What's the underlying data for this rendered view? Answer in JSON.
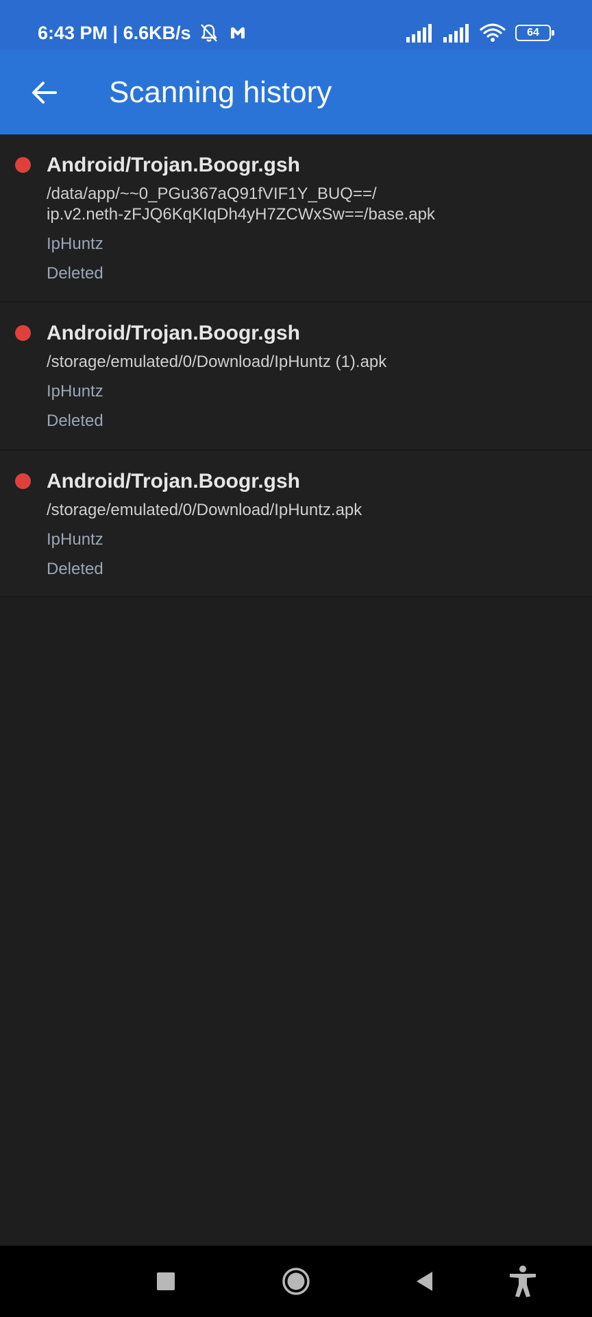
{
  "status_bar": {
    "time": "6:43 PM",
    "separator": " | ",
    "net_speed": "6.6KB/s",
    "battery_level": "64",
    "icons": [
      "bell-off-icon",
      "malwarebytes-icon",
      "signal-icon",
      "signal-icon",
      "wifi-icon",
      "battery-icon"
    ]
  },
  "app_bar": {
    "title": "Scanning history",
    "back_icon": "arrow-left-icon"
  },
  "history": [
    {
      "threat": "Android/Trojan.Boogr.gsh",
      "path": "/data/app/~~0_PGu367aQ91fVIF1Y_BUQ==/\nip.v2.neth-zFJQ6KqKIqDh4yH7ZCWxSw==/base.apk",
      "app": "IpHuntz",
      "status": "Deleted"
    },
    {
      "threat": "Android/Trojan.Boogr.gsh",
      "path": "/storage/emulated/0/Download/IpHuntz (1).apk",
      "app": "IpHuntz",
      "status": "Deleted"
    },
    {
      "threat": "Android/Trojan.Boogr.gsh",
      "path": "/storage/emulated/0/Download/IpHuntz.apk",
      "app": "IpHuntz",
      "status": "Deleted"
    }
  ],
  "nav_bar": {
    "icons": [
      "recents-square-icon",
      "home-circle-icon",
      "back-triangle-icon",
      "accessibility-icon"
    ]
  },
  "colors": {
    "status_bar": "#2a6ccf",
    "app_bar": "#2a74d8",
    "background": "#1e1e1e",
    "threat_dot": "#e0403a"
  }
}
